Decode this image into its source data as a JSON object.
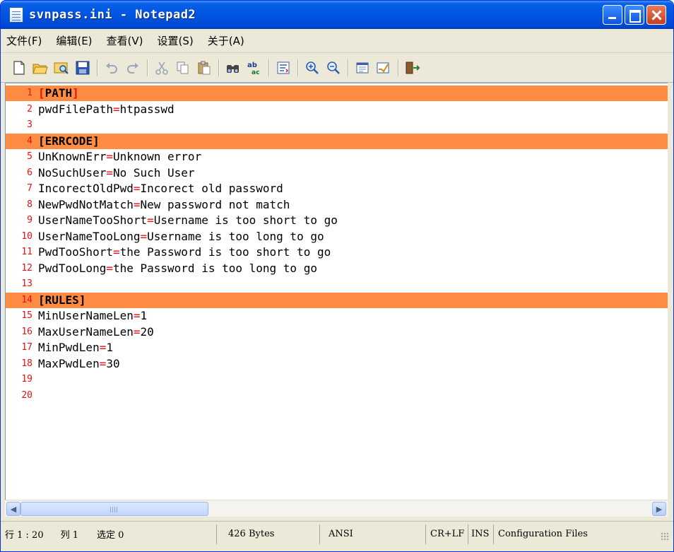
{
  "window": {
    "title": "svnpass.ini - Notepad2"
  },
  "menu": [
    {
      "label": "文件(F)"
    },
    {
      "label": "编辑(E)"
    },
    {
      "label": "查看(V)"
    },
    {
      "label": "设置(S)"
    },
    {
      "label": "关于(A)"
    }
  ],
  "toolbar_icons": [
    "new-file-icon",
    "open-folder-icon",
    "browse-icon",
    "save-icon",
    "undo-icon",
    "redo-icon",
    "cut-icon",
    "copy-icon",
    "paste-icon",
    "find-icon",
    "replace-icon",
    "word-wrap-icon",
    "zoom-in-icon",
    "zoom-out-icon",
    "scheme-icon",
    "customize-scheme-icon",
    "exit-icon"
  ],
  "editor": {
    "lines": [
      {
        "num": "1",
        "type": "section",
        "text": "PATH"
      },
      {
        "num": "2",
        "type": "kv",
        "key": "pwdFilePath",
        "value": "htpasswd"
      },
      {
        "num": "3",
        "type": "blank"
      },
      {
        "num": "4",
        "type": "section",
        "text": "ERRCODE"
      },
      {
        "num": "5",
        "type": "kv",
        "key": "UnKnownErr",
        "value": "Unknown error"
      },
      {
        "num": "6",
        "type": "kv",
        "key": "NoSuchUser",
        "value": "No Such User"
      },
      {
        "num": "7",
        "type": "kv",
        "key": "IncorectOldPwd",
        "value": "Incorect old password"
      },
      {
        "num": "8",
        "type": "kv",
        "key": "NewPwdNotMatch",
        "value": "New password not match"
      },
      {
        "num": "9",
        "type": "kv",
        "key": "UserNameTooShort",
        "value": "Username is too short to go"
      },
      {
        "num": "10",
        "type": "kv",
        "key": "UserNameTooLong",
        "value": "Username is too long to go"
      },
      {
        "num": "11",
        "type": "kv",
        "key": "PwdTooShort",
        "value": "the Password is too short to go"
      },
      {
        "num": "12",
        "type": "kv",
        "key": "PwdTooLong",
        "value": "the Password is too long to go"
      },
      {
        "num": "13",
        "type": "blank"
      },
      {
        "num": "14",
        "type": "section",
        "text": "RULES"
      },
      {
        "num": "15",
        "type": "kv",
        "key": "MinUserNameLen",
        "value": "1"
      },
      {
        "num": "16",
        "type": "kv",
        "key": "MaxUserNameLen",
        "value": "20"
      },
      {
        "num": "17",
        "type": "kv",
        "key": "MinPwdLen",
        "value": "1"
      },
      {
        "num": "18",
        "type": "kv",
        "key": "MaxPwdLen",
        "value": "30"
      },
      {
        "num": "19",
        "type": "blank"
      },
      {
        "num": "20",
        "type": "blank"
      }
    ],
    "colors": {
      "section_highlight": "#ff8c42",
      "line_number": "#e81010",
      "operator": "#e81010"
    }
  },
  "status": {
    "position": "行 1 : 20",
    "column": "列 1",
    "selection": "选定 0",
    "size": "426 Bytes",
    "encoding": "ANSI",
    "line_ending": "CR+LF",
    "insert_mode": "INS",
    "scheme": "Configuration Files"
  }
}
